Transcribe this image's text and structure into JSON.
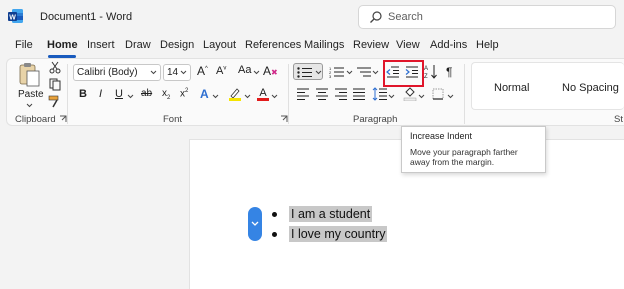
{
  "window": {
    "title": "Document1 - Word"
  },
  "search": {
    "placeholder": "Search"
  },
  "menu": {
    "tabs": [
      "File",
      "Home",
      "Insert",
      "Draw",
      "Design",
      "Layout",
      "References",
      "Mailings",
      "Review",
      "View",
      "Add-ins",
      "Help"
    ],
    "active": "Home"
  },
  "ribbon": {
    "clipboard": {
      "label": "Clipboard",
      "paste_label": "Paste"
    },
    "font": {
      "label": "Font",
      "font_name": "Calibri (Body)",
      "font_size": "14"
    },
    "paragraph": {
      "label": "Paragraph"
    },
    "styles": {
      "items": [
        "Normal",
        "No Spacing"
      ],
      "truncated_label": "St"
    }
  },
  "tooltip": {
    "title": "Increase Indent",
    "description": "Move your paragraph farther away from the margin."
  },
  "document": {
    "bullets": [
      "I am a student",
      "I love my country"
    ]
  },
  "colors": {
    "accent": "#185abd",
    "highlight_border": "#e0152a",
    "selection": "#c8c8c8"
  }
}
